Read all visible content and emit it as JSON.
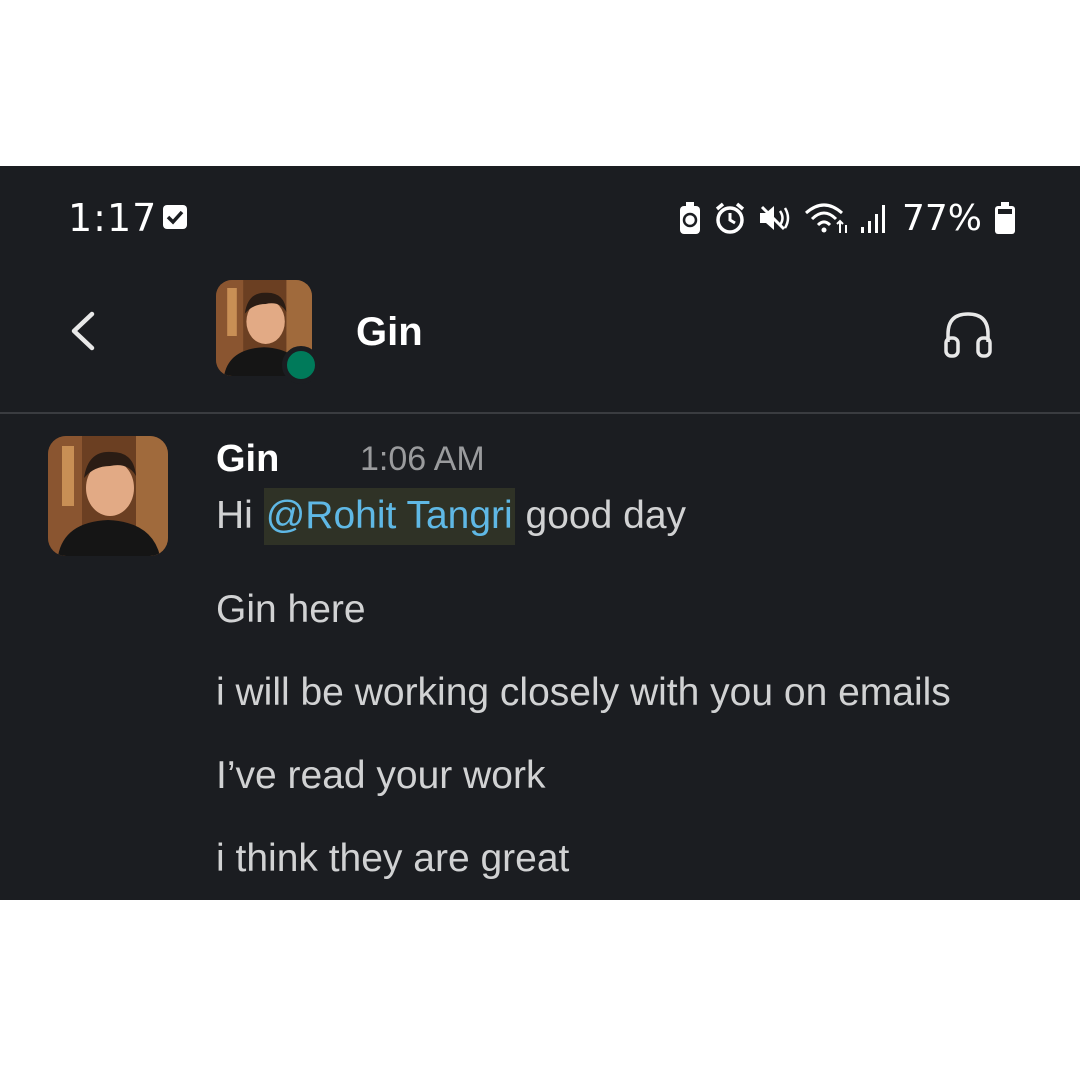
{
  "status_bar": {
    "time": "1:17",
    "battery_percent": "77%",
    "icons": [
      "checkbox-notification-icon",
      "battery-saver-icon",
      "alarm-icon",
      "mute-icon",
      "wifi-icon",
      "signal-icon",
      "battery-icon"
    ]
  },
  "header": {
    "title": "Gin",
    "back_icon": "chevron-left-icon",
    "huddle_icon": "headphones-icon",
    "presence": "active",
    "presence_color": "#007a5a"
  },
  "message": {
    "author": "Gin",
    "timestamp": "1:06 AM",
    "line1_prefix": "Hi",
    "mention": "@Rohit Tangri",
    "line1_suffix": "good day",
    "lines": [
      "Gin here",
      "i will be working closely with you on emails",
      "I’ve read your work",
      "i think they are great"
    ],
    "mention_color": "#5fb8e5"
  },
  "colors": {
    "background": "#1b1d21",
    "text": "#d1d2d3",
    "muted": "#9a9b9d"
  }
}
